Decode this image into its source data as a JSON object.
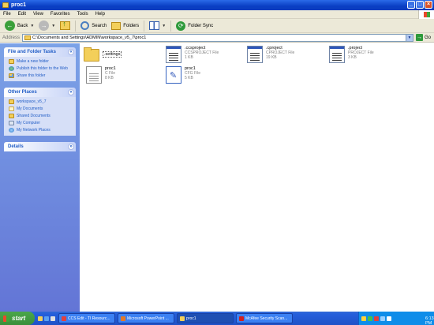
{
  "window": {
    "title": "proc1"
  },
  "menu": [
    "File",
    "Edit",
    "View",
    "Favorites",
    "Tools",
    "Help"
  ],
  "toolbar": {
    "back": "Back",
    "search": "Search",
    "folders": "Folders",
    "folder_sync": "Folder Sync"
  },
  "address": {
    "label": "Address",
    "path": "C:\\Documents and Settings\\ADMIN\\workspace_v5_7\\proc1",
    "go": "Go"
  },
  "left_pane": {
    "file_tasks": {
      "title": "File and Folder Tasks",
      "items": [
        "Make a new folder",
        "Publish this folder to the Web",
        "Share this folder"
      ]
    },
    "other_places": {
      "title": "Other Places",
      "items": [
        "workspace_v5_7",
        "My Documents",
        "Shared Documents",
        "My Computer",
        "My Network Places"
      ]
    },
    "details": {
      "title": "Details"
    }
  },
  "files": [
    {
      "name": ".settings",
      "type": "",
      "size": "",
      "icon": "folder-icon"
    },
    {
      "name": ".ccsproject",
      "type": "CCSPROJECT File",
      "size": "1 KB",
      "icon": "window-file-icon"
    },
    {
      "name": ".cproject",
      "type": "CPROJECT File",
      "size": "19 KB",
      "icon": "window-file-icon"
    },
    {
      "name": ".project",
      "type": "PROJECT File",
      "size": "3 KB",
      "icon": "window-file-icon"
    },
    {
      "name": "proc1",
      "type": "C File",
      "size": "8 KB",
      "icon": "c-file-icon"
    },
    {
      "name": "proc1",
      "type": "CFG File",
      "size": "5 KB",
      "icon": "cfg-file-icon"
    }
  ],
  "taskbar": {
    "start": "start",
    "buttons": [
      "CCS Edit - TI Resourc...",
      "Microsoft PowerPoint ...",
      "proc1",
      "McAfee Security Scan..."
    ],
    "clock": "6:13 PM"
  },
  "colors": {
    "titlebar": "#0a3fc4",
    "left_pane": "#6375d6",
    "link": "#215dc6",
    "start_button": "#3a8f3a"
  }
}
